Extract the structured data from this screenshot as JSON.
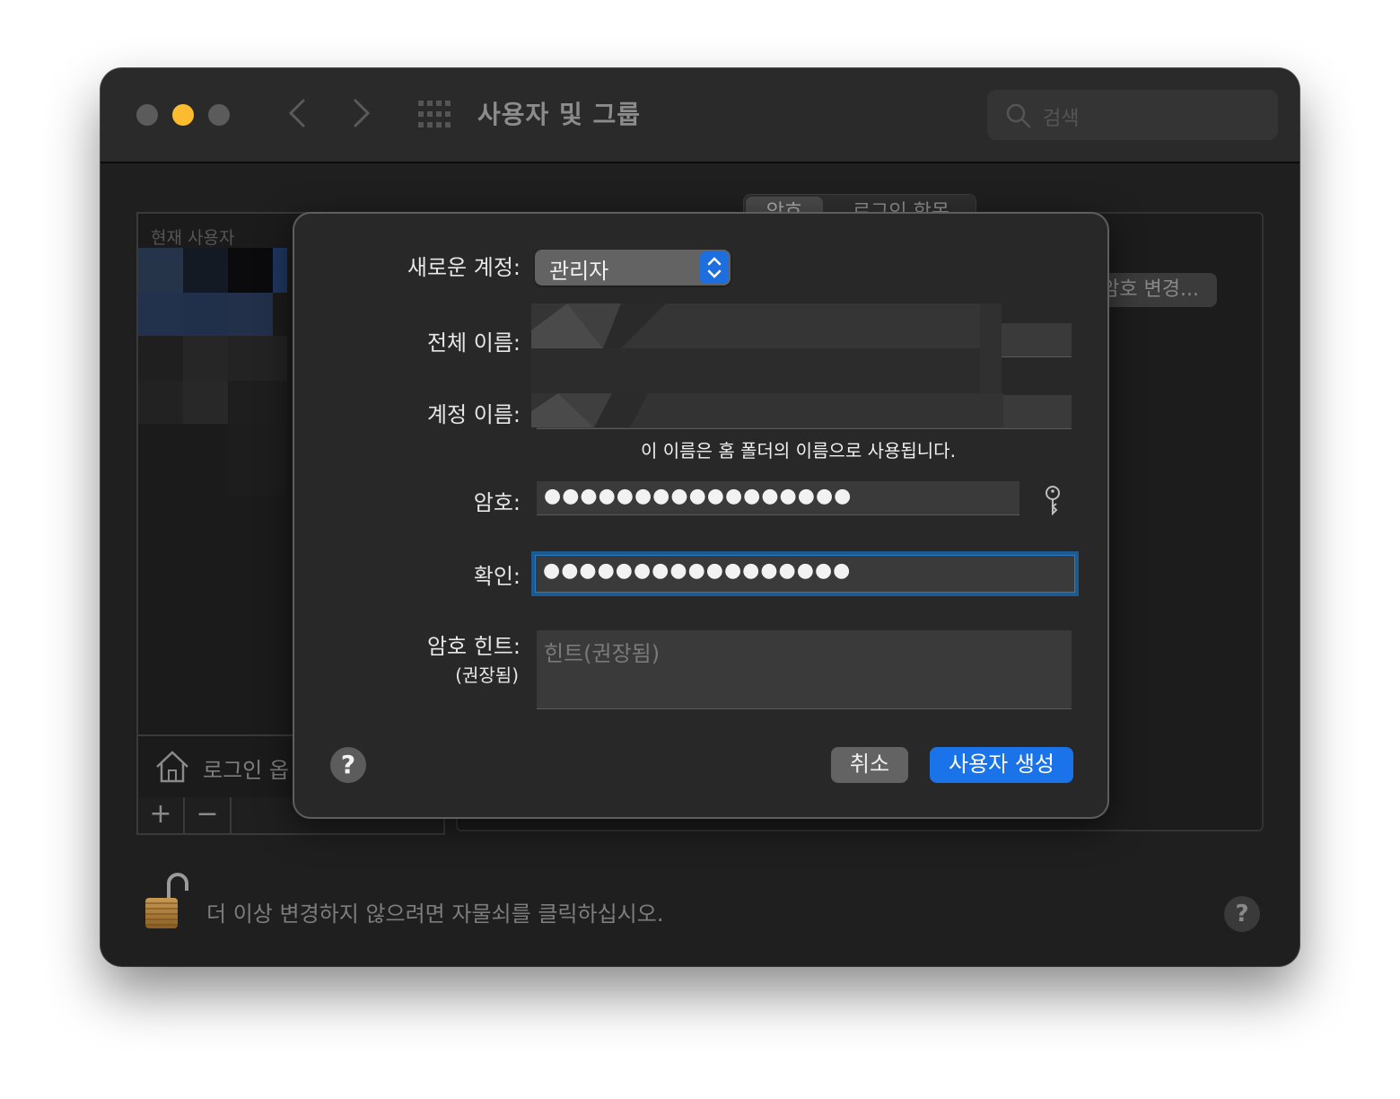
{
  "window": {
    "title": "사용자 및 그룹",
    "search_placeholder": "검색"
  },
  "background": {
    "current_users_header": "현재 사용자",
    "login_options_label": "로그인 옵",
    "tab_password": "암호",
    "tab_login_items": "로그인 항목",
    "change_password_button": "암호 변경...",
    "add_button": "+",
    "remove_button": "−",
    "lock_message": "더 이상 변경하지 않으려면 자물쇠를 클릭하십시오.",
    "help": "?"
  },
  "sheet": {
    "new_account_label": "새로운 계정:",
    "new_account_value": "관리자",
    "full_name_label": "전체 이름:",
    "account_name_label": "계정 이름:",
    "account_name_note": "이 이름은 홈 폴더의 이름으로 사용됩니다.",
    "password_label": "암호:",
    "password_value": "●●●●●●●●●●●●●●●●●",
    "verify_label": "확인:",
    "verify_value": "●●●●●●●●●●●●●●●●●",
    "hint_label": "암호 힌트:",
    "hint_label_sub": "(권장됨)",
    "hint_placeholder": "힌트(권장됨)",
    "help": "?",
    "cancel_button": "취소",
    "create_button": "사용자 생성"
  },
  "colors": {
    "accent": "#1a73e8",
    "focus_ring": "#1c5a8f",
    "minimize": "#fdbb2f"
  }
}
